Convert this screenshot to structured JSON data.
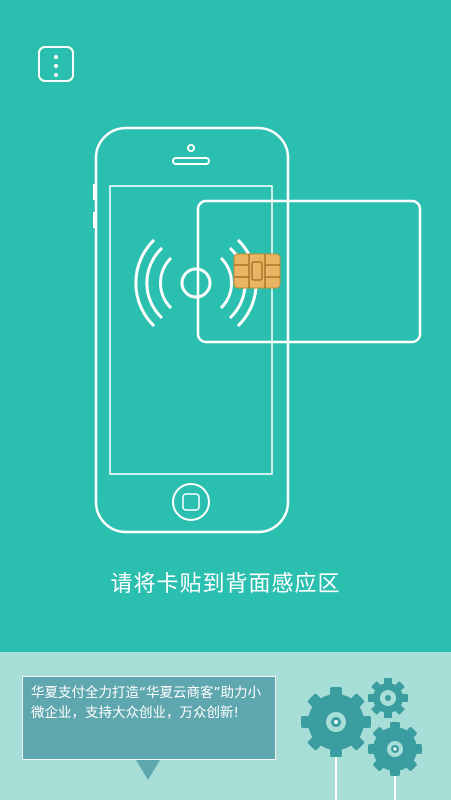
{
  "header": {
    "menu_icon": "more-vertical-icon"
  },
  "main": {
    "instruction": "请将卡贴到背面感应区",
    "illustration_icons": [
      "phone-icon",
      "nfc-waves-icon",
      "card-icon",
      "chip-icon"
    ]
  },
  "promo": {
    "text": "华夏支付全力打造“华夏云商客”助力小微企业，支持大众创业，万众创新!",
    "decor_icons": [
      "gear-icon",
      "gear-icon",
      "gear-icon"
    ]
  },
  "colors": {
    "background": "#2bbfb0",
    "panel": "#a8ded8",
    "bubble": "#5fa7ae",
    "gear": "#3a9d9f",
    "chip": "#e9b565"
  }
}
